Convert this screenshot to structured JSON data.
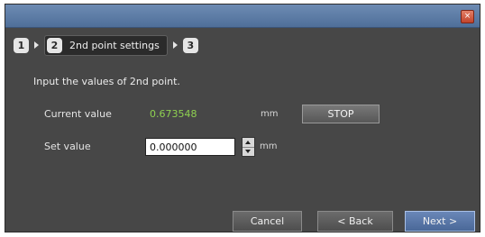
{
  "window": {
    "close_glyph": "×"
  },
  "steps": [
    {
      "number": "1"
    },
    {
      "number": "2",
      "label": "2nd point settings"
    },
    {
      "number": "3"
    }
  ],
  "instruction": "Input the values of 2nd point.",
  "current": {
    "label": "Current value",
    "value": "0.673548",
    "unit": "mm",
    "value_color": "#8fd151"
  },
  "stop_button": {
    "label": "STOP"
  },
  "set": {
    "label": "Set value",
    "value": "0.000000",
    "unit": "mm"
  },
  "buttons": {
    "cancel": "Cancel",
    "back": "< Back",
    "next": "Next >"
  },
  "colors": {
    "titlebar": "#5a7aa6",
    "dialog_bg": "#474747",
    "primary_button": "#5a78a8"
  }
}
